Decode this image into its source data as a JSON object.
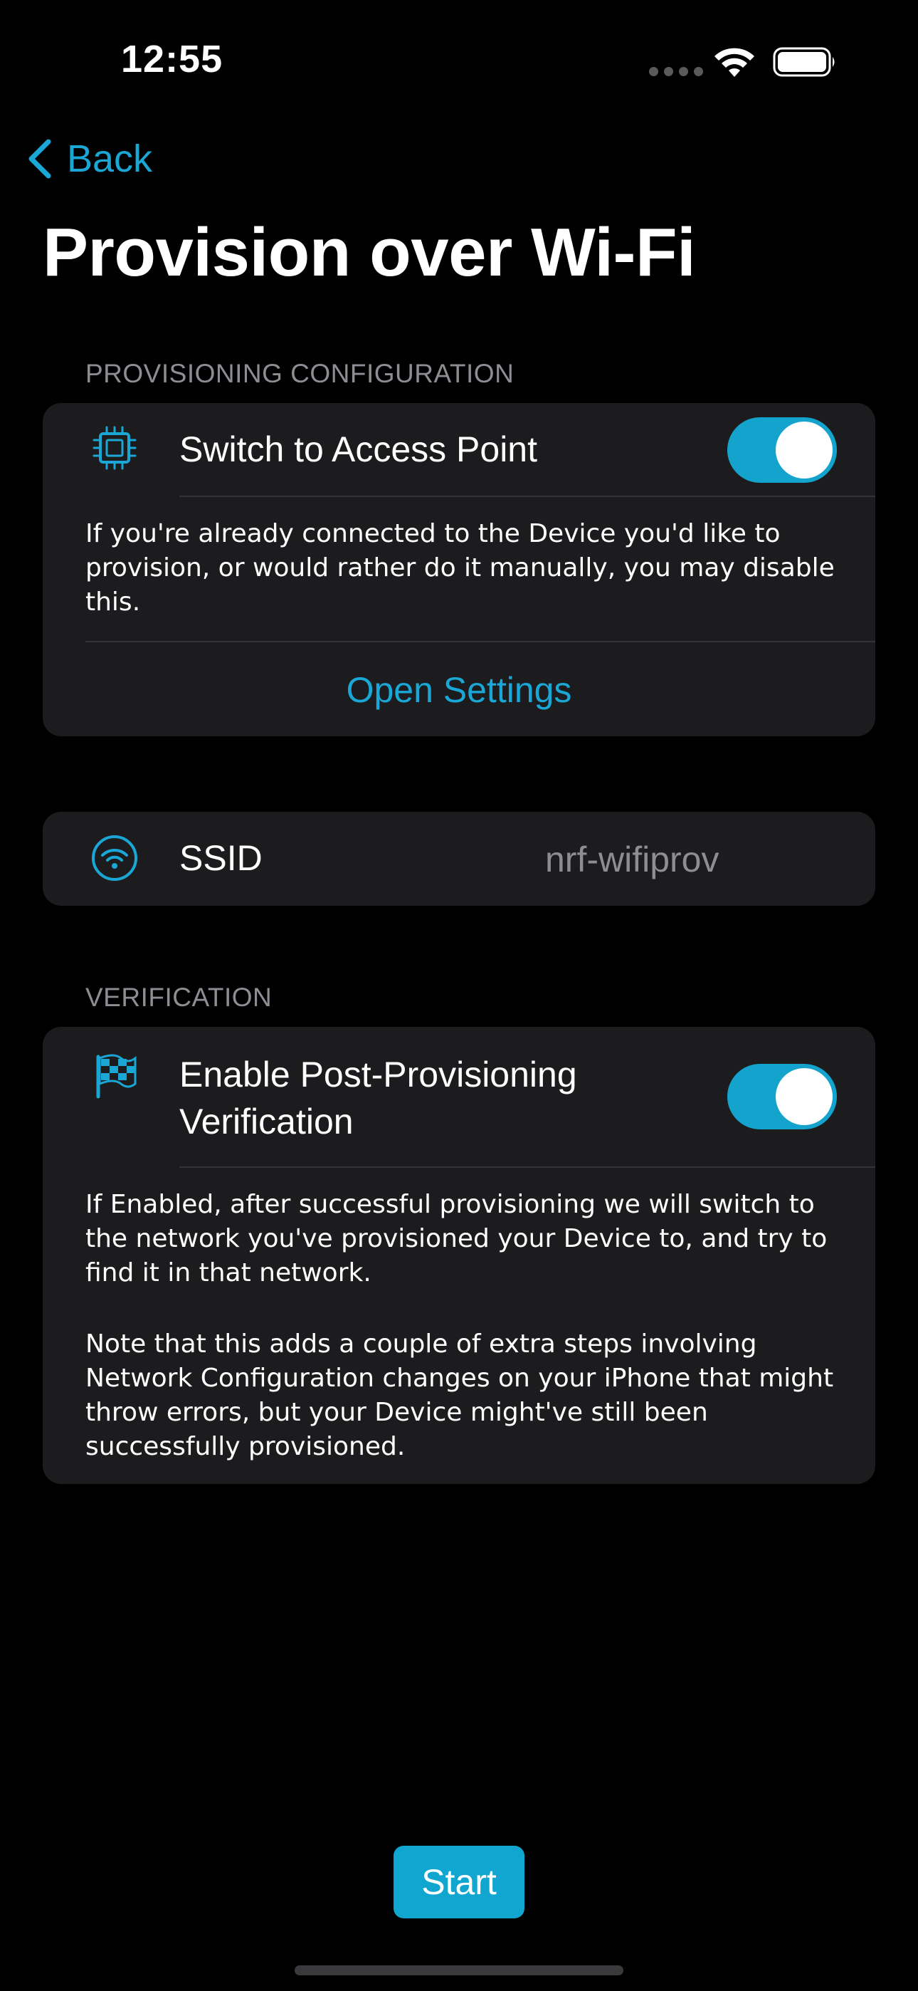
{
  "status_bar": {
    "time": "12:55"
  },
  "nav": {
    "back_label": "Back",
    "title": "Provision over Wi-Fi"
  },
  "provisioning": {
    "header": "PROVISIONING CONFIGURATION",
    "switch_label": "Switch to Access Point",
    "switch_on": true,
    "description": "If you're already connected to the Device you'd like to provision, or would rather do it manually, you may disable this.",
    "open_settings_label": "Open Settings"
  },
  "ssid": {
    "label": "SSID",
    "value": "nrf-wifiprov"
  },
  "verification": {
    "header": "VERIFICATION",
    "toggle_label_line1": "Enable Post-Provisioning",
    "toggle_label_line2": "Verification",
    "toggle_on": true,
    "description_1": "If Enabled, after successful provisioning we will switch to the network you've provisioned your Device to, and try to find it in that network.",
    "description_2": "Note that this adds a couple of extra steps involving Network Configuration changes on your iPhone that might throw errors, but your Device might've still been successfully provisioned."
  },
  "actions": {
    "start_label": "Start"
  },
  "icons": {
    "accent": "#1aa7d6",
    "chip": "chip-icon",
    "wifi": "wifi-icon",
    "flag": "checkered-flag-icon"
  },
  "colors": {
    "background": "#000000",
    "card": "#1c1c1e",
    "toggle_on": "#14a3cc",
    "secondary_text": "#8d8d93"
  }
}
